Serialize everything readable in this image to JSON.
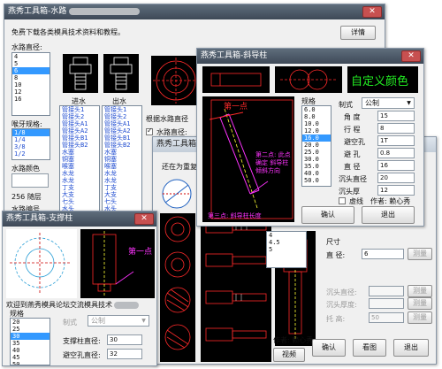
{
  "win_water": {
    "title": "燕秀工具箱-水路",
    "top_link": "免费下载各类模具技术资料和教程。",
    "detail_btn": "详情",
    "diameter_label": "水路直径:",
    "diameter_list": [
      "4",
      "5",
      "6",
      "8",
      "10",
      "12",
      "16"
    ],
    "diameter_selected": 2,
    "thread_label": "喉牙规格:",
    "thread_list": [
      "1/8",
      "1/4",
      "3/8",
      "1/2"
    ],
    "thread_selected": 0,
    "color_label": "水路颜色",
    "color_value": "256 随层",
    "number_label": "水路编号",
    "inlet_label": "进水",
    "outlet_label": "出水",
    "inlet_list": [
      "管接头1",
      "管接头2",
      "管接头A1",
      "管接头A2",
      "管接头B1",
      "管接头B2",
      "水塞",
      "铜塞",
      "喉塞",
      "水龙",
      "水龙",
      "丁支",
      "大支",
      "七头",
      "水头"
    ],
    "outlet_list": [
      "管接头1",
      "管接头2",
      "管接头A1",
      "管接头A2",
      "管接头B1",
      "管接头B2",
      "水塞",
      "铜塞",
      "喉塞",
      "水龙",
      "水龙",
      "丁支",
      "大支",
      "七头",
      "水头"
    ],
    "by_diameter": "根据水路直径",
    "water_diameter_cb": "水路直径:",
    "radio_a": "正",
    "radio_b": "反"
  },
  "win_guide": {
    "title": "燕秀工具箱-斜导柱",
    "custom_color": "自定义颜色",
    "annot1": "第一点",
    "annot2": "第二点: 此点确定 斜导柱倾斜方向",
    "annot3": "第三点: 斜导柱长度",
    "spec_label": "规格",
    "spec_list": [
      "6.0",
      "8.0",
      "10.0",
      "12.0",
      "16.0",
      "20.0",
      "25.0",
      "30.0",
      "35.0",
      "40.0",
      "50.0"
    ],
    "spec_selected": 4,
    "std_label": "制式",
    "std_value": "公制",
    "angle_label": "角  度",
    "angle_value": "15",
    "stroke_label": "行  程",
    "stroke_value": "8",
    "clearance_label": "避空孔",
    "clearance_value": "1T",
    "avoid_label": "避  孔",
    "avoid_value": "0.8",
    "diameter_label": "直  径",
    "diameter_value": "16",
    "sink_d_label": "沉头直径",
    "sink_d_value": "20",
    "sink_t_label": "沉头厚",
    "sink_t_value": "12",
    "dashed_label": "虚线",
    "author": "作者: 赖心秀",
    "ok_btn": "确认",
    "exit_btn": "退出"
  },
  "win_mid": {
    "title": "燕秀工具箱",
    "hint": "还在为重复",
    "spec_list": [
      "4",
      "4.5",
      "5"
    ],
    "spec_selected": 3,
    "size_label": "尺寸",
    "diameter_label": "直  径:",
    "diameter_value": "6",
    "measure": "测量",
    "sink_d_label": "沉头直径:",
    "sink_t_label": "沉头厚度:",
    "tuo_label": "托   高:",
    "tuo_value": "50",
    "author": "作者: 赖心秀",
    "ok_btn": "确认",
    "view_btn": "看图",
    "exit_btn": "退出",
    "video_btn": "视频"
  },
  "win_support": {
    "title": "燕秀工具箱-支撑柱",
    "point": "第一点",
    "welcome": "欢迎到燕秀模具论坛交流模具技术",
    "spec_label": "规格",
    "spec_list": [
      "20",
      "25",
      "30",
      "35",
      "40",
      "45",
      "50",
      "55"
    ],
    "spec_selected": 2,
    "std_label": "制式",
    "std_value": "公制",
    "support_d_label": "支撑柱直径:",
    "support_d_value": "30",
    "avoid_d_label": "避空孔直径:",
    "avoid_d_value": "32"
  },
  "colors": {
    "titlebar": "#4b5665",
    "selection": "#3399ff",
    "cad_bg": "#000000",
    "cad_red": "#ff2a2a",
    "cad_magenta": "#ff33ff",
    "cad_yellow": "#ffff33",
    "custom_color_text": "#22ee22"
  }
}
